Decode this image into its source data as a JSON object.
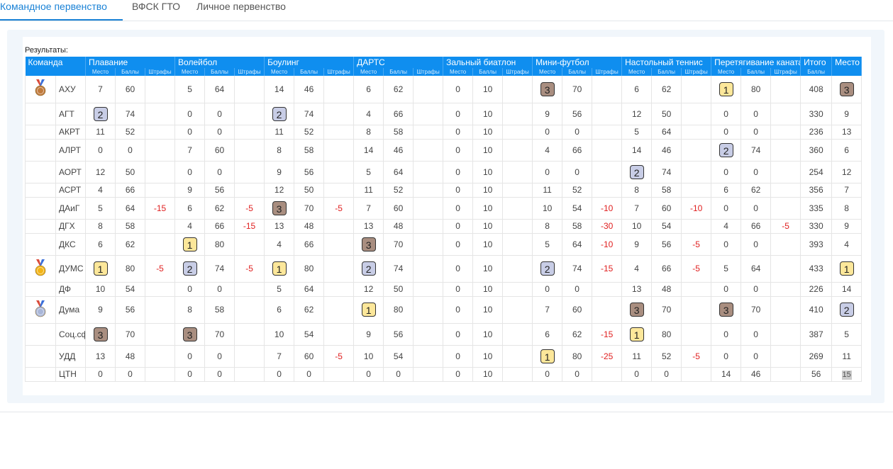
{
  "tabs": [
    {
      "label": "Командное первенство",
      "active": true
    },
    {
      "label": "ВФСК ГТО",
      "active": false
    },
    {
      "label": "Личное первенство",
      "active": false
    }
  ],
  "results_label": "Результаты:",
  "colors": {
    "accent": "#0f8eef",
    "gold": "#fce79a",
    "silver": "#c8cde6",
    "bronze": "#a98e80",
    "penalty": "#e02020"
  },
  "table": {
    "team_header": "Команда",
    "sports": [
      "Плавание",
      "Волейбол",
      "Боулинг",
      "ДАРТС",
      "Зальный биатлон",
      "Мини-футбол",
      "Настольный теннис",
      "Перетягивание каната"
    ],
    "sub_headers": [
      "Место",
      "Баллы",
      "Штрафы"
    ],
    "total_header": "Итого",
    "total_sub": "Баллы",
    "place_header": "Место",
    "rows": [
      {
        "team": "АХУ",
        "medal": "bronze-medal-icon",
        "sports": [
          [
            7,
            60,
            ""
          ],
          [
            5,
            64,
            ""
          ],
          [
            14,
            46,
            ""
          ],
          [
            6,
            62,
            ""
          ],
          [
            0,
            10,
            ""
          ],
          [
            3,
            70,
            ""
          ],
          [
            6,
            62,
            ""
          ],
          [
            1,
            80,
            ""
          ]
        ],
        "total": 408,
        "place": 3
      },
      {
        "team": "АГТ",
        "medal": "",
        "sports": [
          [
            2,
            74,
            ""
          ],
          [
            0,
            0,
            ""
          ],
          [
            2,
            74,
            ""
          ],
          [
            4,
            66,
            ""
          ],
          [
            0,
            10,
            ""
          ],
          [
            9,
            56,
            ""
          ],
          [
            12,
            50,
            ""
          ],
          [
            0,
            0,
            ""
          ]
        ],
        "total": 330,
        "place": 9
      },
      {
        "team": "АКРТ",
        "medal": "",
        "sports": [
          [
            11,
            52,
            ""
          ],
          [
            0,
            0,
            ""
          ],
          [
            11,
            52,
            ""
          ],
          [
            8,
            58,
            ""
          ],
          [
            0,
            10,
            ""
          ],
          [
            0,
            0,
            ""
          ],
          [
            5,
            64,
            ""
          ],
          [
            0,
            0,
            ""
          ]
        ],
        "total": 236,
        "place": 13
      },
      {
        "team": "АЛРТ",
        "medal": "",
        "sports": [
          [
            0,
            0,
            ""
          ],
          [
            7,
            60,
            ""
          ],
          [
            8,
            58,
            ""
          ],
          [
            14,
            46,
            ""
          ],
          [
            0,
            10,
            ""
          ],
          [
            4,
            66,
            ""
          ],
          [
            14,
            46,
            ""
          ],
          [
            2,
            74,
            ""
          ]
        ],
        "total": 360,
        "place": 6
      },
      {
        "team": "АОРТ",
        "medal": "",
        "sports": [
          [
            12,
            50,
            ""
          ],
          [
            0,
            0,
            ""
          ],
          [
            9,
            56,
            ""
          ],
          [
            5,
            64,
            ""
          ],
          [
            0,
            10,
            ""
          ],
          [
            0,
            0,
            ""
          ],
          [
            2,
            74,
            ""
          ],
          [
            0,
            0,
            ""
          ]
        ],
        "total": 254,
        "place": 12
      },
      {
        "team": "АСРТ",
        "medal": "",
        "sports": [
          [
            4,
            66,
            ""
          ],
          [
            9,
            56,
            ""
          ],
          [
            12,
            50,
            ""
          ],
          [
            11,
            52,
            ""
          ],
          [
            0,
            10,
            ""
          ],
          [
            11,
            52,
            ""
          ],
          [
            8,
            58,
            ""
          ],
          [
            6,
            62,
            ""
          ]
        ],
        "total": 356,
        "place": 7
      },
      {
        "team": "ДАиГ",
        "medal": "",
        "sports": [
          [
            5,
            64,
            "-15"
          ],
          [
            6,
            62,
            "-5"
          ],
          [
            3,
            70,
            "-5"
          ],
          [
            7,
            60,
            ""
          ],
          [
            0,
            10,
            ""
          ],
          [
            10,
            54,
            "-10"
          ],
          [
            7,
            60,
            "-10"
          ],
          [
            0,
            0,
            ""
          ]
        ],
        "total": 335,
        "place": 8
      },
      {
        "team": "ДГХ",
        "medal": "",
        "sports": [
          [
            8,
            58,
            ""
          ],
          [
            4,
            66,
            "-15"
          ],
          [
            13,
            48,
            ""
          ],
          [
            13,
            48,
            ""
          ],
          [
            0,
            10,
            ""
          ],
          [
            8,
            58,
            "-30"
          ],
          [
            10,
            54,
            ""
          ],
          [
            4,
            66,
            "-5"
          ]
        ],
        "total": 330,
        "place": 9
      },
      {
        "team": "ДКС",
        "medal": "",
        "sports": [
          [
            6,
            62,
            ""
          ],
          [
            1,
            80,
            ""
          ],
          [
            4,
            66,
            ""
          ],
          [
            3,
            70,
            ""
          ],
          [
            0,
            10,
            ""
          ],
          [
            5,
            64,
            "-10"
          ],
          [
            9,
            56,
            "-5"
          ],
          [
            0,
            0,
            ""
          ]
        ],
        "total": 393,
        "place": 4
      },
      {
        "team": "ДУМС",
        "medal": "gold-medal-icon",
        "sports": [
          [
            1,
            80,
            "-5"
          ],
          [
            2,
            74,
            "-5"
          ],
          [
            1,
            80,
            ""
          ],
          [
            2,
            74,
            ""
          ],
          [
            0,
            10,
            ""
          ],
          [
            2,
            74,
            "-15"
          ],
          [
            4,
            66,
            "-5"
          ],
          [
            5,
            64,
            ""
          ]
        ],
        "total": 433,
        "place": 1
      },
      {
        "team": "ДФ",
        "medal": "",
        "sports": [
          [
            10,
            54,
            ""
          ],
          [
            0,
            0,
            ""
          ],
          [
            5,
            64,
            ""
          ],
          [
            12,
            50,
            ""
          ],
          [
            0,
            10,
            ""
          ],
          [
            0,
            0,
            ""
          ],
          [
            13,
            48,
            ""
          ],
          [
            0,
            0,
            ""
          ]
        ],
        "total": 226,
        "place": 14
      },
      {
        "team": "Дума",
        "medal": "silver-medal-icon",
        "sports": [
          [
            9,
            56,
            ""
          ],
          [
            8,
            58,
            ""
          ],
          [
            6,
            62,
            ""
          ],
          [
            1,
            80,
            ""
          ],
          [
            0,
            10,
            ""
          ],
          [
            7,
            60,
            ""
          ],
          [
            3,
            70,
            ""
          ],
          [
            3,
            70,
            ""
          ]
        ],
        "total": 410,
        "place": 2
      },
      {
        "team": "Соц.сф",
        "medal": "",
        "sports": [
          [
            3,
            70,
            ""
          ],
          [
            3,
            70,
            ""
          ],
          [
            10,
            54,
            ""
          ],
          [
            9,
            56,
            ""
          ],
          [
            0,
            10,
            ""
          ],
          [
            6,
            62,
            "-15"
          ],
          [
            1,
            80,
            ""
          ],
          [
            0,
            0,
            ""
          ]
        ],
        "total": 387,
        "place": 5
      },
      {
        "team": "УДД",
        "medal": "",
        "sports": [
          [
            13,
            48,
            ""
          ],
          [
            0,
            0,
            ""
          ],
          [
            7,
            60,
            "-5"
          ],
          [
            10,
            54,
            ""
          ],
          [
            0,
            10,
            ""
          ],
          [
            1,
            80,
            "-25"
          ],
          [
            11,
            52,
            "-5"
          ],
          [
            0,
            0,
            ""
          ]
        ],
        "total": 269,
        "place": 11
      },
      {
        "team": "ЦТН",
        "medal": "",
        "sports": [
          [
            0,
            0,
            ""
          ],
          [
            0,
            0,
            ""
          ],
          [
            0,
            0,
            ""
          ],
          [
            0,
            0,
            ""
          ],
          [
            0,
            10,
            ""
          ],
          [
            0,
            0,
            ""
          ],
          [
            0,
            0,
            ""
          ],
          [
            14,
            46,
            ""
          ]
        ],
        "total": 56,
        "place": 15
      }
    ]
  }
}
